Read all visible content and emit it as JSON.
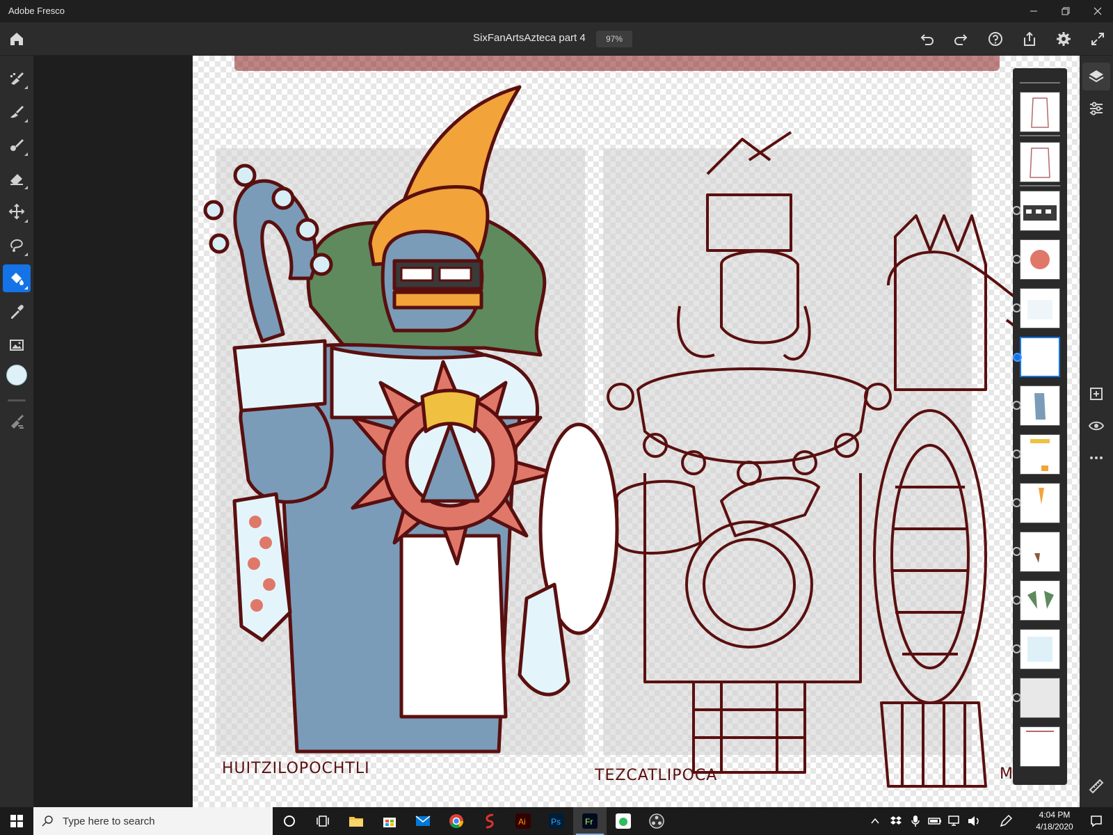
{
  "window": {
    "app_title": "Adobe Fresco"
  },
  "toolbar": {
    "doc_title": "SixFanArtsAzteca part 4",
    "zoom": "97%"
  },
  "canvas": {
    "labels": [
      "HUITZILOPOCHTLI",
      "TEZCATLIPOCA",
      "MAQU"
    ]
  },
  "tools": [
    "pixel-brush",
    "live-brush",
    "vector-brush",
    "eraser",
    "move-transform",
    "lasso-selection",
    "fill",
    "eyedropper",
    "place-image",
    "color",
    "smudge"
  ],
  "colors": {
    "accent": "#1473e6",
    "current_color": "#dff1f8",
    "outline": "#5a0f0f"
  },
  "taskbar": {
    "search_placeholder": "Type here to search",
    "time": "4:04 PM",
    "date": "4/18/2020"
  }
}
